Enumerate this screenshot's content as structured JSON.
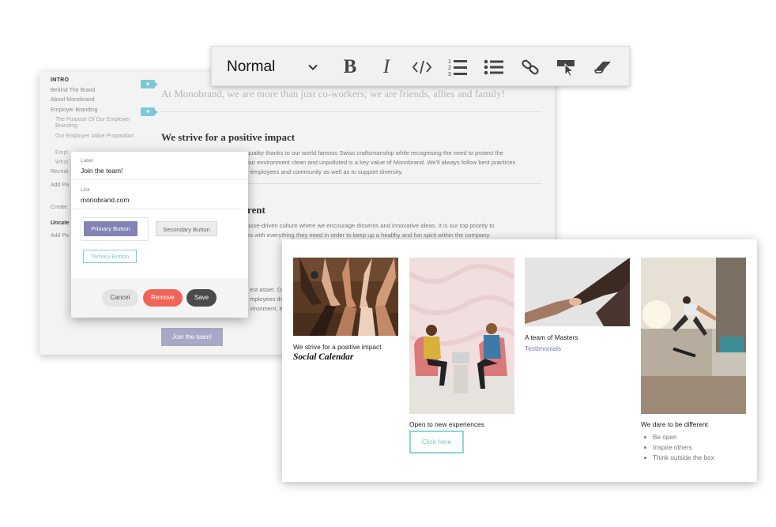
{
  "outline": {
    "intro_heading": "INTRO",
    "items": [
      "Behind The Brand",
      "About Monobrand",
      "Employer Branding",
      "The Purpose Of Our Employer Branding",
      "Our Employer Value Proposition",
      "Empl",
      "What",
      "Recruit",
      "Add Pa"
    ],
    "create": "Create",
    "uncategorized": "Uncate",
    "add_page": "Add Pa",
    "plus": "+"
  },
  "content": {
    "intro_line": "At Monobrand, we are more than just co-workers; we are friends, allies and family!",
    "heading_1": "We strive for a positive impact",
    "para_1": [
      "quality thanks to our world famous Swiss craftsmanship while recognising the need to protect the",
      "our environment clean and unpolluted is a key value of Monobrand. We'll always follow best practices",
      "r employees and community as well as to support diversity."
    ],
    "heading_2": "rent",
    "para_2": [
      "pose-driven culture where we encourage dissents and innovative ideas. It is our top priority to",
      "es with everything they need in order to keep up a healthy and fun spirit within the company."
    ],
    "para_3": [
      "est asset. Ou",
      "mployees the",
      "vironment, e"
    ],
    "join_button": "Join the team!"
  },
  "modal": {
    "label_caption": "Label",
    "label_value": "Join the team!",
    "link_caption": "Link",
    "link_value": "monobrand.com",
    "primary": "Primary Button",
    "secondary": "Secondary Button",
    "tertiary": "Tertiary Button",
    "cancel": "Cancel",
    "remove": "Remove",
    "save": "Save"
  },
  "toolbar": {
    "style_value": "Normal",
    "bold": "B",
    "italic": "I",
    "icons": [
      "chevron-down-icon",
      "bold-icon",
      "italic-icon",
      "code-icon",
      "ordered-list-icon",
      "bullet-list-icon",
      "link-icon",
      "link-cursor-icon",
      "eraser-icon"
    ]
  },
  "preview": {
    "col1_caption": "We strive for a positive impact",
    "col1_title": "Social Calendar",
    "col2_caption": "Open to new experiences",
    "col2_button": "Click here",
    "col3_caption": "A team of Masters",
    "col3_link": "Testimonials",
    "col4_caption": "We dare to be different",
    "col4_bullets": [
      "Be open",
      "Inspire others",
      "Think outside the box"
    ]
  },
  "colors": {
    "primary": "#8282b4",
    "teal": "#7fc7d6",
    "remove": "#f06458",
    "save": "#4b4b4b",
    "link": "#7f7fb0"
  }
}
